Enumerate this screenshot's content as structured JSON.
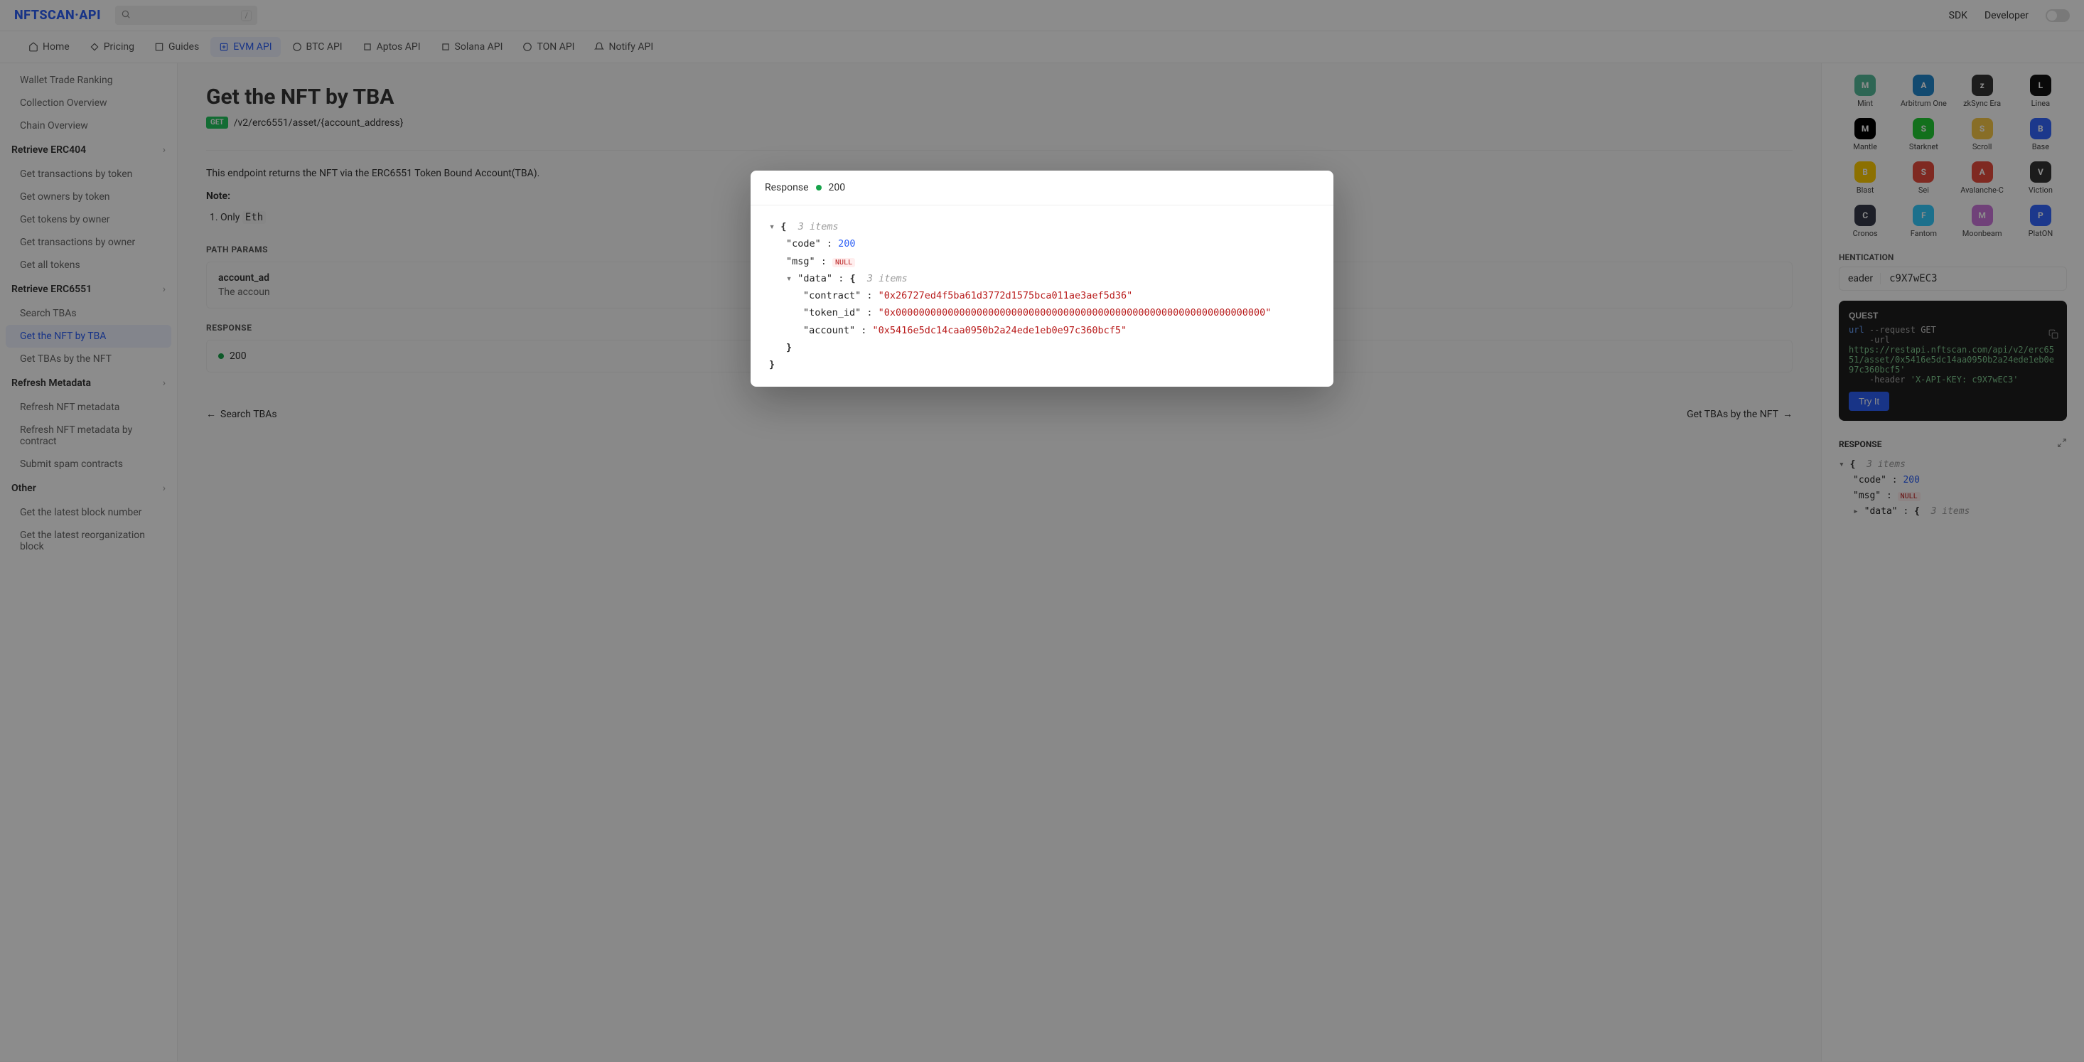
{
  "topbar": {
    "logo": "NFTSCAN·API",
    "search_placeholder": "",
    "slash_hint": "/",
    "links": {
      "sdk": "SDK",
      "developer": "Developer"
    }
  },
  "navbar": [
    {
      "label": "Home"
    },
    {
      "label": "Pricing"
    },
    {
      "label": "Guides"
    },
    {
      "label": "EVM API",
      "active": true
    },
    {
      "label": "BTC API"
    },
    {
      "label": "Aptos API"
    },
    {
      "label": "Solana API"
    },
    {
      "label": "TON API"
    },
    {
      "label": "Notify API"
    }
  ],
  "sidebar": [
    {
      "label": "Wallet Trade Ranking"
    },
    {
      "label": "Collection Overview"
    },
    {
      "label": "Chain Overview"
    },
    {
      "label": "Retrieve ERC404",
      "heading": true,
      "expandable": true
    },
    {
      "label": "Get transactions by token"
    },
    {
      "label": "Get owners by token"
    },
    {
      "label": "Get tokens by owner"
    },
    {
      "label": "Get transactions by owner"
    },
    {
      "label": "Get all tokens"
    },
    {
      "label": "Retrieve ERC6551",
      "heading": true,
      "expandable": true
    },
    {
      "label": "Search TBAs"
    },
    {
      "label": "Get the NFT by TBA",
      "active": true
    },
    {
      "label": "Get TBAs by the NFT"
    },
    {
      "label": "Refresh Metadata",
      "heading": true,
      "expandable": true
    },
    {
      "label": "Refresh NFT metadata"
    },
    {
      "label": "Refresh NFT metadata by contract"
    },
    {
      "label": "Submit spam contracts"
    },
    {
      "label": "Other",
      "heading": true,
      "expandable": true
    },
    {
      "label": "Get the latest block number"
    },
    {
      "label": "Get the latest reorganization block"
    }
  ],
  "page": {
    "title": "Get the NFT by TBA",
    "method": "GET",
    "path": "/v2/erc6551/asset/{account_address}",
    "descr": "This endpoint returns the NFT via the ERC6551 Token Bound Account(TBA).",
    "note_label": "Note:",
    "note_1_prefix": "1. Only ",
    "note_1_code": "Eth",
    "path_params_heading": "PATH PARAMS",
    "param": {
      "name_prefix": "account_ad",
      "desc_prefix": "The accoun"
    },
    "response_heading": "RESPONSE",
    "response_code": "200",
    "prev": "Search TBAs",
    "next": "Get TBAs by the NFT"
  },
  "networks": [
    "Mint",
    "Arbitrum One",
    "zkSync Era",
    "Linea",
    "Mantle",
    "Starknet",
    "Scroll",
    "Base",
    "Blast",
    "Sei",
    "Avalanche-C",
    "Viction",
    "Cronos",
    "Fantom",
    "Moonbeam",
    "PlatON"
  ],
  "auth": {
    "heading_suffix": "HENTICATION",
    "label_suffix": "eader",
    "value": "c9X7wEC3"
  },
  "request": {
    "heading_suffix": "QUEST",
    "curl": "url",
    "flag_req": "--request",
    "method": "GET",
    "flag_url": "-url",
    "url": "https://restapi.nftscan.com/api/v2/erc6551/asset/0x5416e5dc14aa0950b2a24ede1eb0e97c360bcf5'",
    "url_line2_prefix": "aa0950b2a24ede1eb0e97c360bcf5'",
    "flag_hdr": "-header",
    "hdr": "'X-API-KEY: c9X7wEC3'",
    "try_it": "Try It"
  },
  "right_response": {
    "heading": "RESPONSE",
    "root_count": "3 items",
    "code_key": "\"code\"",
    "code_val": "200",
    "msg_key": "\"msg\"",
    "msg_val": "NULL",
    "data_key": "\"data\"",
    "data_count": "3 items"
  },
  "modal": {
    "label": "Response",
    "status": "200",
    "root_count": "3 items",
    "code_key": "\"code\"",
    "code_val": "200",
    "msg_key": "\"msg\"",
    "msg_val": "NULL",
    "data_key": "\"data\"",
    "data_count": "3 items",
    "contract_key": "\"contract\"",
    "contract_val": "\"0x26727ed4f5ba61d3772d1575bca011ae3aef5d36\"",
    "token_key": "\"token_id\"",
    "token_val": "\"0x0000000000000000000000000000000000000000000000000000000000000000\"",
    "account_key": "\"account\"",
    "account_val": "\"0x5416e5dc14caa0950b2a24ede1eb0e97c360bcf5\""
  }
}
